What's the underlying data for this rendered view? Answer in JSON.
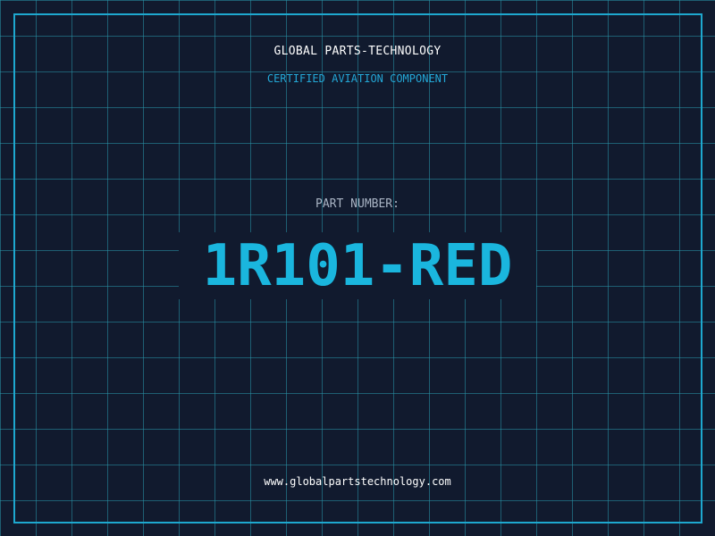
{
  "header": {
    "company": "GLOBAL PARTS-TECHNOLOGY",
    "subtitle": "CERTIFIED AVIATION COMPONENT"
  },
  "part": {
    "label": "PART NUMBER:",
    "number": "1R101-RED"
  },
  "footer": {
    "url": "www.globalpartstechnology.com"
  },
  "colors": {
    "background": "#111a2e",
    "grid": "#2896aa",
    "accent": "#1ab6de",
    "frame": "#1ea8cf",
    "label": "#a9b4c4",
    "text": "#ffffff"
  }
}
